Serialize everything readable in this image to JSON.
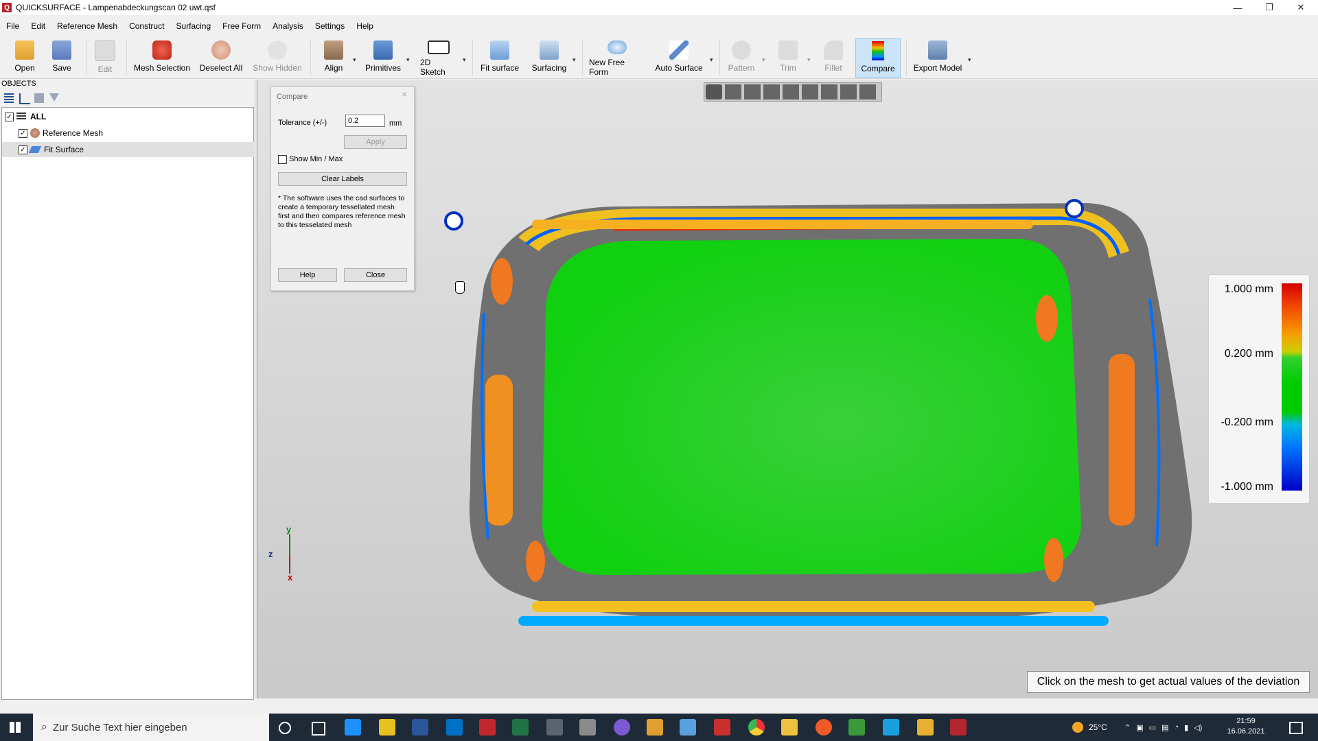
{
  "window": {
    "title": "QUICKSURFACE - Lampenabdeckungscan 02 uwt.qsf",
    "app_icon_letter": "Q",
    "controls": {
      "minimize": "—",
      "maximize": "❐",
      "close": "✕"
    }
  },
  "menu": [
    "File",
    "Edit",
    "Reference Mesh",
    "Construct",
    "Surfacing",
    "Free Form",
    "Analysis",
    "Settings",
    "Help"
  ],
  "toolbar": {
    "open": "Open",
    "save": "Save",
    "edit": "Edit",
    "mesh_selection": "Mesh Selection",
    "deselect_all": "Deselect All",
    "show_hidden": "Show Hidden",
    "align": "Align",
    "primitives": "Primitives",
    "sketch2d": "2D Sketch",
    "fit_surface": "Fit surface",
    "surfacing": "Surfacing",
    "new_free_form": "New Free Form",
    "auto_surface": "Auto Surface",
    "pattern": "Pattern",
    "trim": "Trim",
    "fillet": "Fillet",
    "compare": "Compare",
    "export_model": "Export Model",
    "dropdown_glyph": "▾"
  },
  "objects": {
    "header": "OBJECTS",
    "tree": {
      "all": "ALL",
      "reference_mesh": "Reference Mesh",
      "fit_surface": "Fit Surface"
    }
  },
  "compare_dialog": {
    "title": "Compare",
    "tolerance_label": "Tolerance (+/-)",
    "tolerance_value": "0.2",
    "unit": "mm",
    "apply": "Apply",
    "show_minmax": "Show Min / Max",
    "clear_labels": "Clear Labels",
    "note": "* The software uses the cad surfaces to create a temporary tessellated mesh first and then compares reference mesh to this tesselated mesh",
    "help": "Help",
    "close": "Close",
    "close_glyph": "✕"
  },
  "legend": {
    "ticks": [
      "1.000 mm",
      "0.200 mm",
      "-0.200 mm",
      "-1.000 mm"
    ],
    "colors": {
      "max": "#d40000",
      "tol_hi": "#f7a000",
      "in_tol": "#00cc00",
      "tol_lo": "#00b8e0",
      "min": "#0000c8"
    }
  },
  "hint": "Click on the mesh to get actual values of the deviation",
  "axes": {
    "y": "y",
    "z": "z",
    "x": "x"
  },
  "taskbar": {
    "search_placeholder": "Zur Suche Text hier eingeben",
    "temperature": "25°C",
    "time": "21:59",
    "date": "16.06.2021"
  }
}
